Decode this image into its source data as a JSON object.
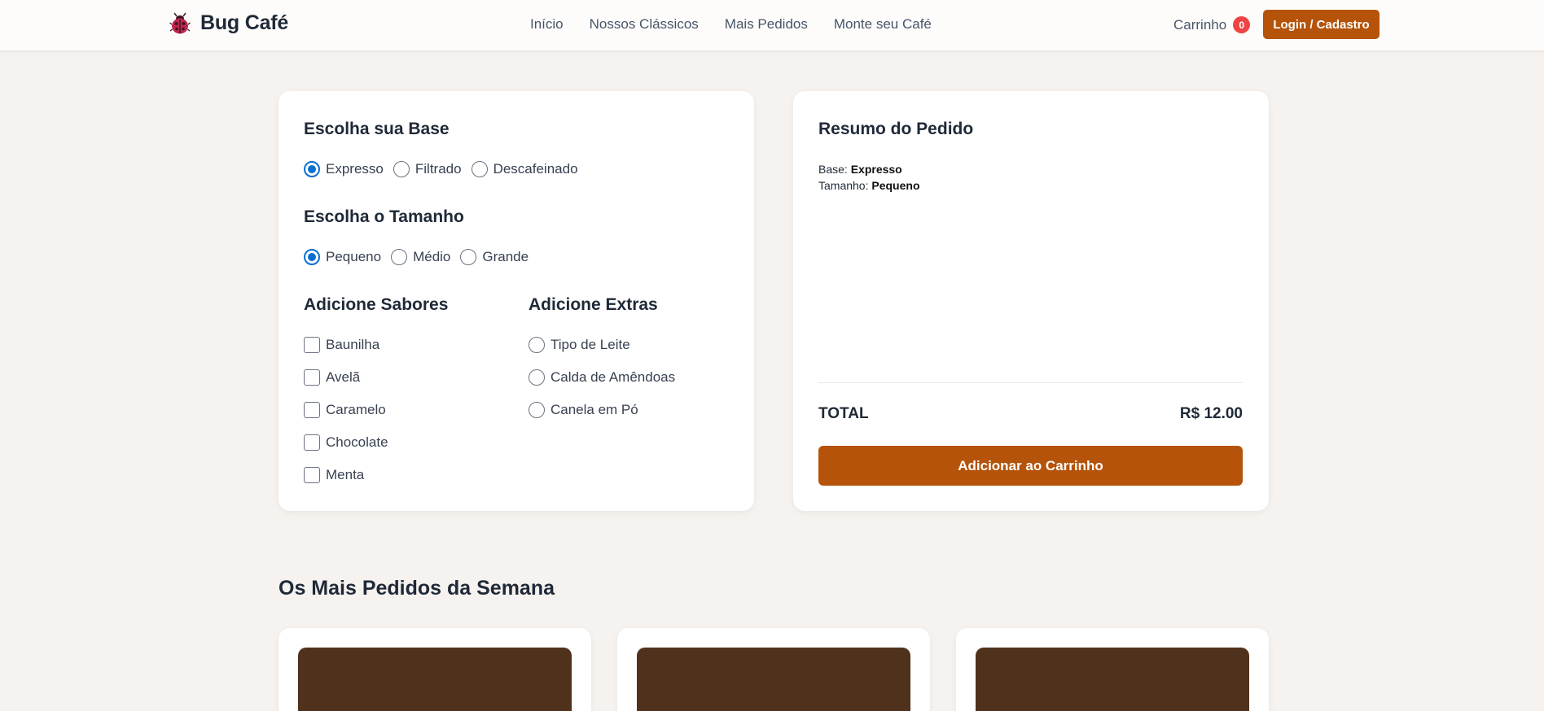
{
  "header": {
    "brand": "Bug Café",
    "nav": [
      "Início",
      "Nossos Clássicos",
      "Mais Pedidos",
      "Monte seu Café"
    ],
    "cart_label": "Carrinho",
    "cart_count": "0",
    "login_label": "Login / Cadastro"
  },
  "builder": {
    "base": {
      "title": "Escolha sua Base",
      "options": [
        "Expresso",
        "Filtrado",
        "Descafeinado"
      ],
      "selected": "Expresso"
    },
    "size": {
      "title": "Escolha o Tamanho",
      "options": [
        "Pequeno",
        "Médio",
        "Grande"
      ],
      "selected": "Pequeno"
    },
    "flavors": {
      "title": "Adicione Sabores",
      "options": [
        "Baunilha",
        "Avelã",
        "Caramelo",
        "Chocolate",
        "Menta"
      ]
    },
    "extras": {
      "title": "Adicione Extras",
      "options": [
        "Tipo de Leite",
        "Calda de Amêndoas",
        "Canela em Pó"
      ]
    }
  },
  "summary": {
    "title": "Resumo do Pedido",
    "base_label": "Base:",
    "base_value": "Expresso",
    "size_label": "Tamanho:",
    "size_value": "Pequeno",
    "total_label": "TOTAL",
    "total_value": "R$ 12.00",
    "add_label": "Adicionar ao Carrinho"
  },
  "popular": {
    "title": "Os Mais Pedidos da Semana",
    "card_count": 3
  },
  "colors": {
    "accent": "#b45309",
    "radio_checked": "#0b6fd1",
    "badge": "#ef4444",
    "page_bg": "#f6f2ef",
    "product_image": "#4f311c"
  },
  "icons": {
    "brand": "ladybug-icon"
  }
}
